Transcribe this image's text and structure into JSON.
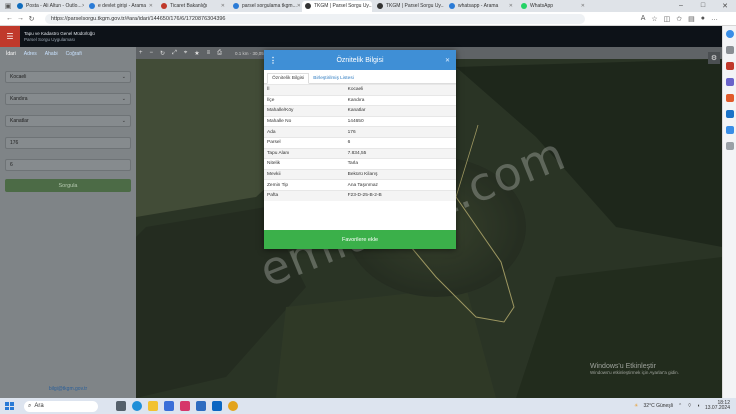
{
  "browser": {
    "tabs": [
      {
        "label": "Posta - Ali Altun - Outlo...",
        "color": "#0f6cbd",
        "active": false
      },
      {
        "label": "e devlet girişi - Arama",
        "color": "#2a7bd6",
        "active": false
      },
      {
        "label": "Ticaret Bakanlığı",
        "color": "#c0392b",
        "active": false
      },
      {
        "label": "parsel sorgulama tkgm...",
        "color": "#2a7bd6",
        "active": false
      },
      {
        "label": "TKGM | Parsel Sorgu Uy...",
        "color": "#333333",
        "active": true
      },
      {
        "label": "TKGM | Parsel Sorgu Uy...",
        "color": "#333333",
        "active": false
      },
      {
        "label": "whatsapp - Arama",
        "color": "#2a7bd6",
        "active": false
      },
      {
        "label": "WhatsApp",
        "color": "#25d366",
        "active": false
      }
    ],
    "url": "https://parselsorgu.tkgm.gov.tr/#ara/idari/144650/176/6/1720876304396"
  },
  "app": {
    "title_line1": "Tapu ve Kadastro Genel Müdürlüğü",
    "title_line2": "Parsel Sorgu Uygulaması",
    "menu_icon": "☰"
  },
  "sidebar": {
    "tabs": [
      "İdari",
      "Adres",
      "Ahabi",
      "Coğrafi"
    ],
    "province": "Kocaeli",
    "district": "Kandıra",
    "neighborhood": "Kanatlar",
    "block": "176",
    "parcel": "6",
    "search_label": "Sorgula",
    "footer": "bilgi@tkgm.gov.tr"
  },
  "map": {
    "scale_text": "0.1 km   · 30,05 ...",
    "watermark": "emlakjet.com"
  },
  "dialog": {
    "title": "Öznitelik Bilgisi",
    "close_label": "✕",
    "tabs": [
      "Öznitelik Bilgisi",
      "Birleştirilmiş Listesi"
    ],
    "rows": [
      {
        "key": "İl",
        "value": "Kocaeli"
      },
      {
        "key": "İlçe",
        "value": "Kandıra"
      },
      {
        "key": "Mahalle/Köy",
        "value": "Kanatlar"
      },
      {
        "key": "Mahalle No",
        "value": "144650"
      },
      {
        "key": "Ada",
        "value": "176"
      },
      {
        "key": "Parsel",
        "value": "6"
      },
      {
        "key": "Tapu Alanı",
        "value": "7.834,55"
      },
      {
        "key": "Nitelik",
        "value": "Tarla"
      },
      {
        "key": "Mevkii",
        "value": "Bekürü Kilarış"
      },
      {
        "key": "Zemin Tip",
        "value": "Ana Taşınmaz"
      },
      {
        "key": "Pafta",
        "value": "F23-D-25-B-2-B"
      }
    ],
    "fav_label": "Favorilere ekle"
  },
  "windows_notice": {
    "line1": "Windows'u Etkinleştir",
    "line2": "Windows'u etkinleştirmek için Ayarlar'a gidin."
  },
  "taskbar": {
    "search_placeholder": "Ara",
    "weather": "32°C  Güneşli",
    "time": "18:12",
    "date": "13.07.2024"
  }
}
